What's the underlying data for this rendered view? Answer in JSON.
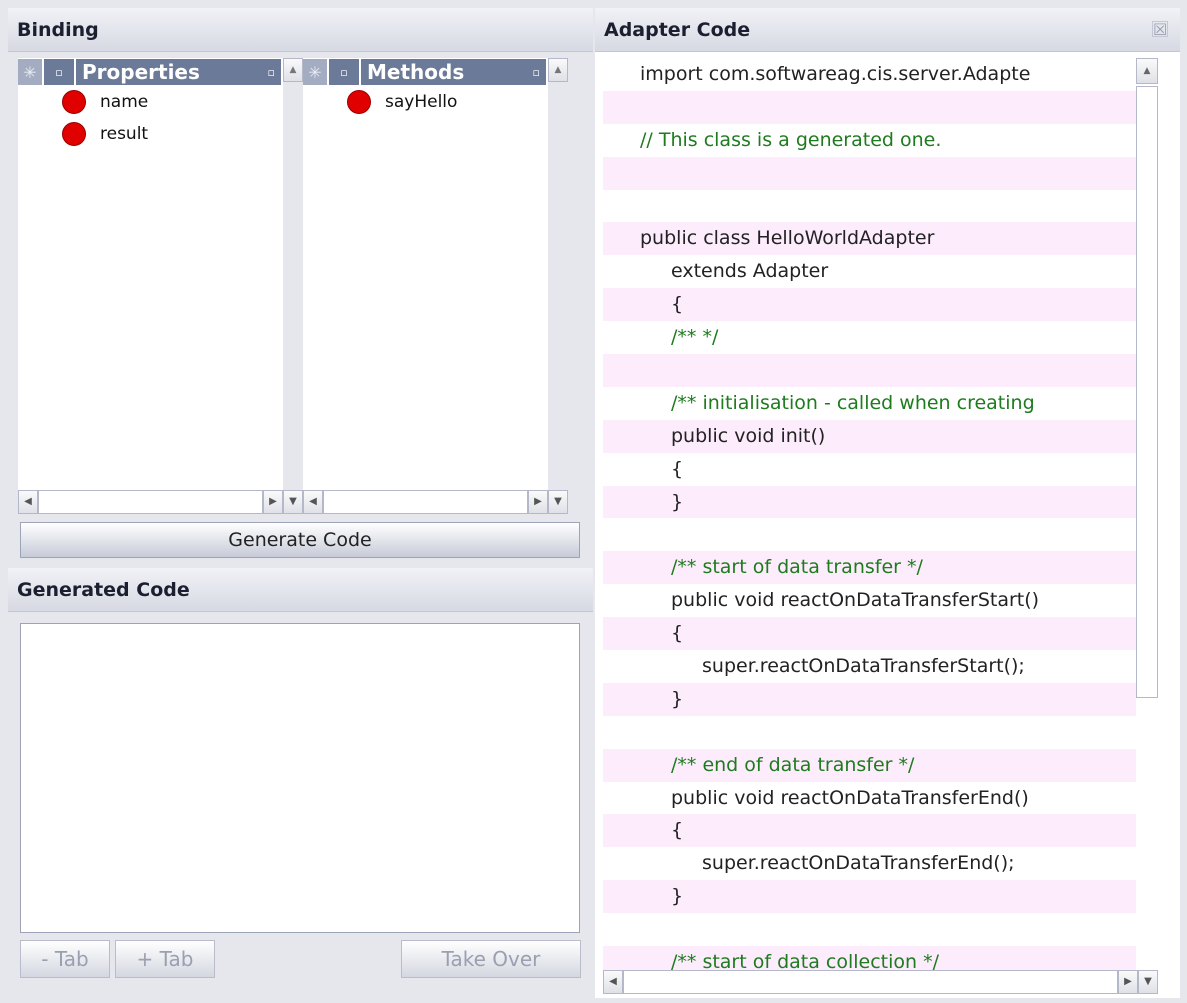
{
  "binding": {
    "title": "Binding",
    "properties": {
      "header": "Properties",
      "items": [
        "name",
        "result"
      ]
    },
    "methods": {
      "header": "Methods",
      "items": [
        "sayHello"
      ]
    },
    "star_glyph": "✳",
    "square_glyph": "▫"
  },
  "generate_button": "Generate Code",
  "generated": {
    "title": "Generated Code",
    "minus_tab": "- Tab",
    "plus_tab": "+ Tab",
    "take_over": "Take Over"
  },
  "adapter": {
    "title": "Adapter Code",
    "close_glyph": "☒",
    "lines": [
      {
        "text": "import com.softwareag.cis.server.Adapte",
        "indent": 0,
        "pink": false,
        "comment": false
      },
      {
        "text": "",
        "indent": 0,
        "pink": true,
        "comment": false
      },
      {
        "text": "// This class is a generated one.",
        "indent": 0,
        "pink": false,
        "comment": true
      },
      {
        "text": "",
        "indent": 0,
        "pink": true,
        "comment": false
      },
      {
        "text": "",
        "indent": 0,
        "pink": false,
        "comment": false
      },
      {
        "text": "public class HelloWorldAdapter",
        "indent": 0,
        "pink": true,
        "comment": false
      },
      {
        "text": "extends Adapter",
        "indent": 1,
        "pink": false,
        "comment": false
      },
      {
        "text": "{",
        "indent": 1,
        "pink": true,
        "comment": false
      },
      {
        "text": "/** */",
        "indent": 1,
        "pink": false,
        "comment": true
      },
      {
        "text": "",
        "indent": 0,
        "pink": true,
        "comment": false
      },
      {
        "text": "/** initialisation - called when creating",
        "indent": 1,
        "pink": false,
        "comment": true
      },
      {
        "text": "public void init()",
        "indent": 1,
        "pink": true,
        "comment": false
      },
      {
        "text": "{",
        "indent": 1,
        "pink": false,
        "comment": false
      },
      {
        "text": "}",
        "indent": 1,
        "pink": true,
        "comment": false
      },
      {
        "text": "",
        "indent": 0,
        "pink": false,
        "comment": false
      },
      {
        "text": "/** start of data transfer */",
        "indent": 1,
        "pink": true,
        "comment": true
      },
      {
        "text": "public void reactOnDataTransferStart()",
        "indent": 1,
        "pink": false,
        "comment": false
      },
      {
        "text": "{",
        "indent": 1,
        "pink": true,
        "comment": false
      },
      {
        "text": "super.reactOnDataTransferStart();",
        "indent": 2,
        "pink": false,
        "comment": false
      },
      {
        "text": "}",
        "indent": 1,
        "pink": true,
        "comment": false
      },
      {
        "text": "",
        "indent": 0,
        "pink": false,
        "comment": false
      },
      {
        "text": "/** end of data transfer */",
        "indent": 1,
        "pink": true,
        "comment": true
      },
      {
        "text": "public void reactOnDataTransferEnd()",
        "indent": 1,
        "pink": false,
        "comment": false
      },
      {
        "text": "{",
        "indent": 1,
        "pink": true,
        "comment": false
      },
      {
        "text": "super.reactOnDataTransferEnd();",
        "indent": 2,
        "pink": false,
        "comment": false
      },
      {
        "text": "}",
        "indent": 1,
        "pink": true,
        "comment": false
      },
      {
        "text": "",
        "indent": 0,
        "pink": false,
        "comment": false
      },
      {
        "text": "/** start of data collection */",
        "indent": 1,
        "pink": true,
        "comment": true
      }
    ]
  },
  "colors": {
    "header_blue": "#6c7a99",
    "comment_green": "#1e7b1e",
    "pink_row": "#fcecfc",
    "status_red": "#e00000"
  },
  "icons": {
    "scroll_up": "▲",
    "scroll_down": "▼",
    "scroll_left": "◀",
    "scroll_right": "▶"
  }
}
